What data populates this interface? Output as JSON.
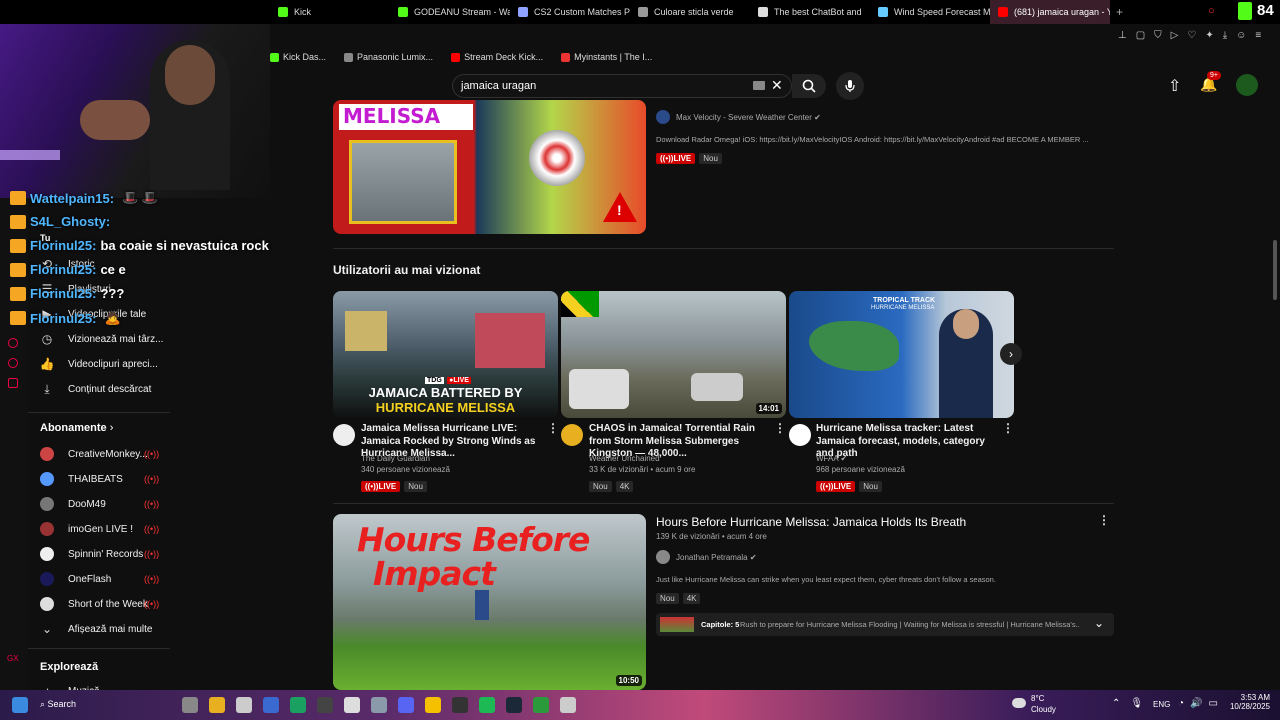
{
  "browser": {
    "tabs": [
      {
        "label": "Kick",
        "color": "#53fc18",
        "active": false
      },
      {
        "label": "GODEANU Stream - Wat",
        "color": "#53fc18",
        "active": false
      },
      {
        "label": "CS2 Custom Matches Pri",
        "color": "#8fa3ff",
        "active": false
      },
      {
        "label": "Culoare sticla verde",
        "color": "#999",
        "active": false
      },
      {
        "label": "The best ChatBot and",
        "color": "#ddd",
        "active": false
      },
      {
        "label": "Wind Speed Forecast Ma",
        "color": "#6cf",
        "active": false
      },
      {
        "label": "(681) jamaica uragan - Yo",
        "color": "#ff0000",
        "active": true
      }
    ],
    "new_tab": "+",
    "kick_count": "84",
    "bookmarks": [
      {
        "label": "Kick Das...",
        "color": "#53fc18"
      },
      {
        "label": "Panasonic Lumix...",
        "color": "#888"
      },
      {
        "label": "Stream Deck Kick...",
        "color": "#f00"
      },
      {
        "label": "Myinstants | The I...",
        "color": "#e33"
      }
    ]
  },
  "header": {
    "search_value": "jamaica uragan",
    "notif_count": "9+"
  },
  "chat": [
    {
      "user": "Wattelpain15:",
      "msg": "",
      "emoji": "🎩 🎩"
    },
    {
      "user": "S4L_Ghosty:",
      "msg": "",
      "emoji": ""
    },
    {
      "user": "Florinul25:",
      "msg": "ba coaie si nevastuica rock",
      "emoji": ""
    },
    {
      "user": "Florinul25:",
      "msg": "ce e",
      "emoji": ""
    },
    {
      "user": "Florinul25:",
      "msg": "???",
      "emoji": ""
    },
    {
      "user": "Florinul25:",
      "msg": "",
      "emoji": "🙇"
    }
  ],
  "sidebar": {
    "top_label": "Tu",
    "items": [
      {
        "label": "Istoric",
        "icon": "history-icon",
        "glyph": "⟲"
      },
      {
        "label": "Playlisturi",
        "icon": "playlist-icon",
        "glyph": "☰"
      },
      {
        "label": "Videoclipurile tale",
        "icon": "video-icon",
        "glyph": "▶"
      },
      {
        "label": "Vizionează mai târz...",
        "icon": "clock-icon",
        "glyph": "◷"
      },
      {
        "label": "Videoclipuri apreci...",
        "icon": "thumb-up-icon",
        "glyph": "👍"
      },
      {
        "label": "Conținut descărcat",
        "icon": "download-icon",
        "glyph": "⤓"
      }
    ],
    "subs_title": "Abonamente",
    "subs": [
      {
        "label": "CreativeMonkey...",
        "color": "#c44"
      },
      {
        "label": "THAIBEATS",
        "color": "#59f"
      },
      {
        "label": "DooM49",
        "color": "#777"
      },
      {
        "label": "imoGen LIVE !",
        "color": "#933"
      },
      {
        "label": "Spinnin' Records",
        "color": "#eee"
      },
      {
        "label": "OneFlash",
        "color": "#1a1a5a"
      },
      {
        "label": "Short of the Week",
        "color": "#ddd"
      }
    ],
    "show_more": "Afișează mai multe",
    "explore_title": "Explorează",
    "explore_first": "Muzică"
  },
  "top_video": {
    "thumb_text": "MELISSA",
    "channel": "Max Velocity - Severe Weather Center",
    "description": "Download Radar Omega! iOS: https://bit.ly/MaxVelocityIOS Android: https://bit.ly/MaxVelocityAndroid #ad BECOME A MEMBER ...",
    "live": "LIVE",
    "new": "Nou"
  },
  "shelf": {
    "title": "Utilizatorii au mai vizionat",
    "videos": [
      {
        "title": "Jamaica Melissa Hurricane LIVE: Jamaica Rocked by Strong Winds as Hurricane Melissa...",
        "channel": "The Daily Guardian",
        "views": "340 persoane vizionează",
        "live": "LIVE",
        "new": "Nou",
        "thumb_title": "JAMAICA BATTERED BY",
        "thumb_sub": "HURRICANE MELISSA",
        "thumb_logo": "TDG",
        "thumb_live": "●LIVE"
      },
      {
        "title": "CHAOS in Jamaica! Torrential Rain from Storm Melissa Submerges Kingston — 48,000...",
        "channel": "Weather Unchained",
        "views": "33 K de vizionări • acum 9 ore",
        "new": "Nou",
        "quality": "4K",
        "duration": "14:01"
      },
      {
        "title": "Hurricane Melissa tracker: Latest Jamaica forecast, models, category and path",
        "channel": "WFAA",
        "views": "968 persoane vizionează",
        "live": "LIVE",
        "new": "Nou",
        "thumb_title": "TROPICAL TRACK",
        "thumb_sub": "HURRICANE MELISSA"
      }
    ]
  },
  "bottom_video": {
    "title": "Hours Before Hurricane Melissa: Jamaica Holds Its Breath",
    "views": "139 K de vizionări • acum 4 ore",
    "channel": "Jonathan Petramala",
    "description": "Just like Hurricane Melissa can strike when you least expect them, cyber threats don't follow a season.",
    "new": "Nou",
    "quality": "4K",
    "duration": "10:50",
    "thumb_line1": "Hours Before",
    "thumb_line2": "Impact",
    "chapters_label": "Capitole: 5",
    "chapters_text": "Rush to prepare for Hurricane Melissa Flooding | Waiting for Melissa is stressful | Hurricane Melissa's..."
  },
  "taskbar": {
    "search": "Search",
    "weather_temp": "8°C",
    "weather_desc": "Cloudy",
    "lang": "ENG",
    "time": "3:53 AM",
    "date": "10/28/2025"
  }
}
